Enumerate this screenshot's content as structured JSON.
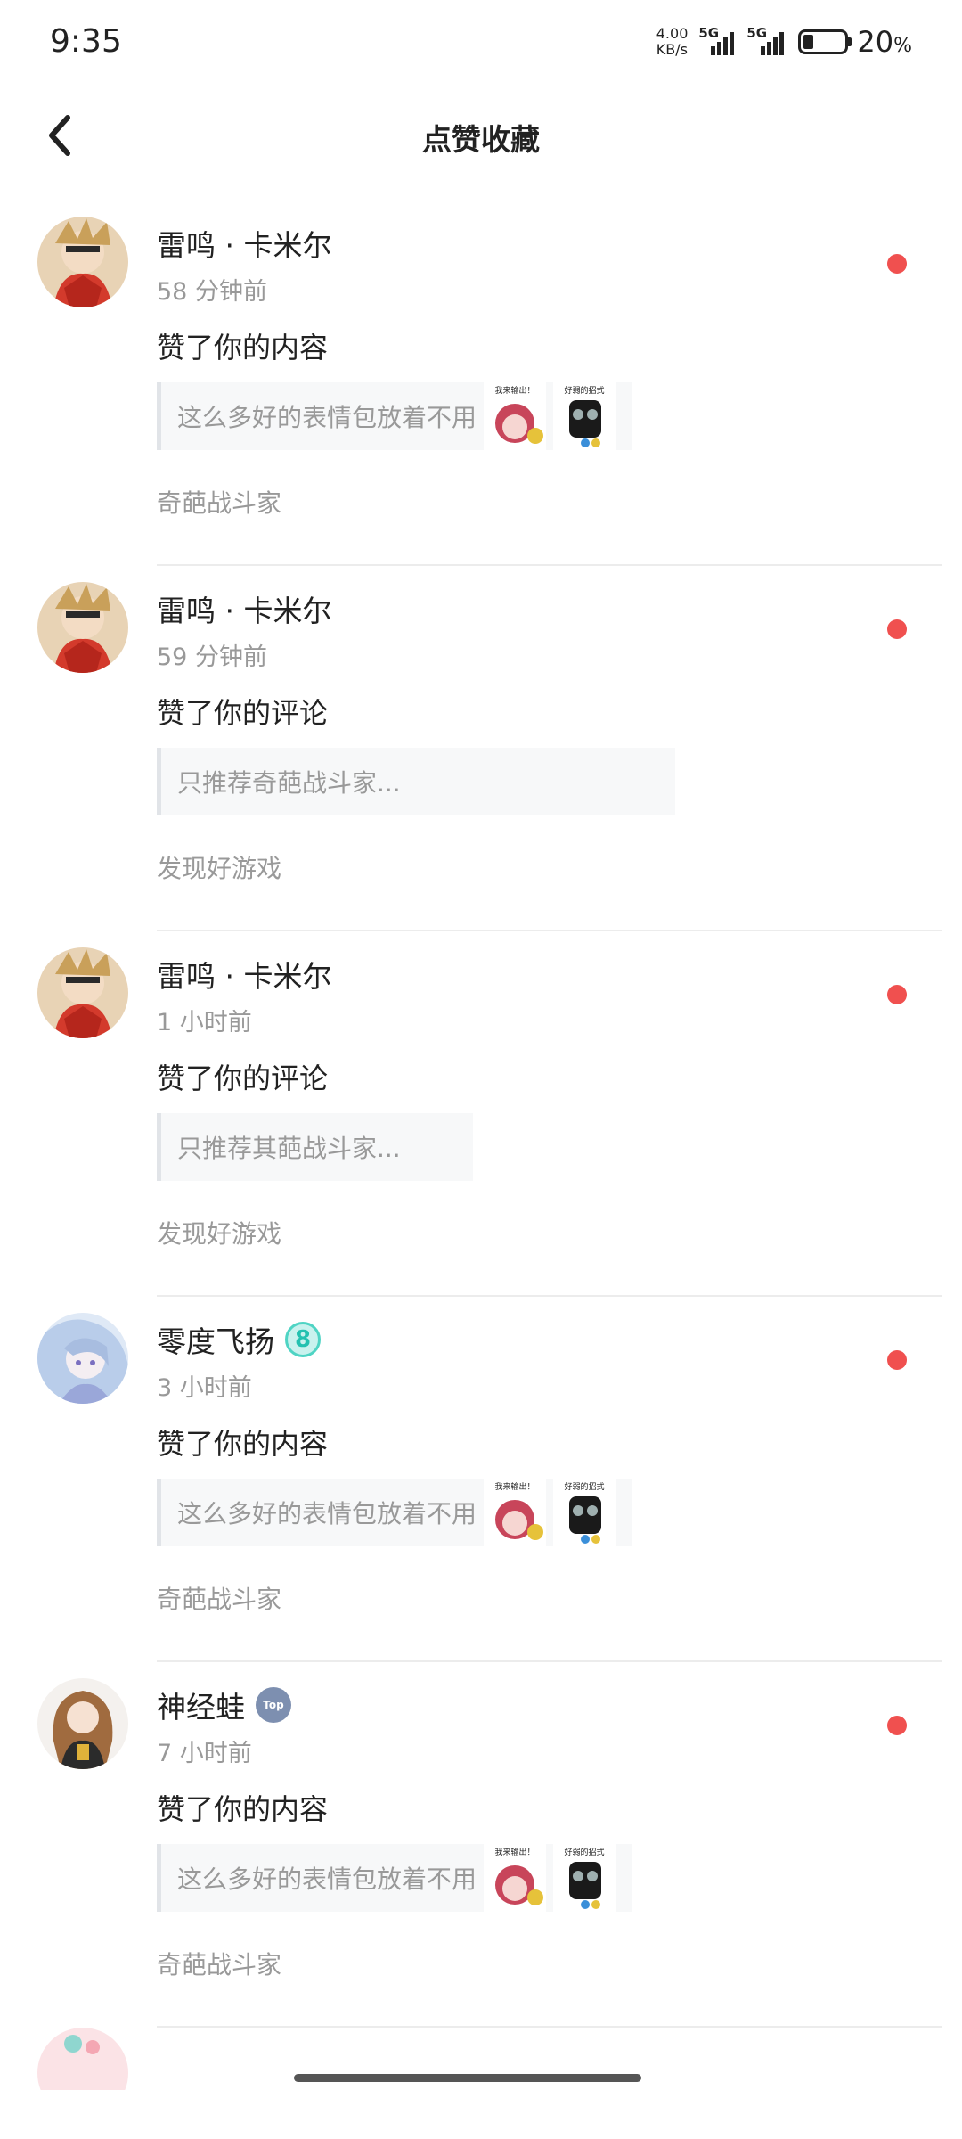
{
  "status_bar": {
    "time": "9:35",
    "net_speed_value": "4.00",
    "net_speed_unit": "KB/s",
    "sim1_label": "5G",
    "sim2_label": "5G",
    "battery_pct": "20",
    "battery_pct_sign": "%"
  },
  "header": {
    "title": "点赞收藏",
    "back_icon": "chevron-left-icon"
  },
  "colors": {
    "unread_dot": "#f0504f",
    "muted_text": "#999999",
    "quote_bg": "#f7f8f9"
  },
  "notifications": [
    {
      "user": "雷鸣 · 卡米尔",
      "time": "58 分钟前",
      "action": "赞了你的内容",
      "quote": "这么多好的表情包放着不用",
      "sticker1_text": "我来输出！",
      "sticker2_text": "好弱的招式",
      "source": "奇葩战斗家",
      "unread": true
    },
    {
      "user": "雷鸣 · 卡米尔",
      "time": "59 分钟前",
      "action": "赞了你的评论",
      "quote": "只推荐奇葩战斗家...",
      "source": "发现好游戏",
      "unread": true
    },
    {
      "user": "雷鸣 · 卡米尔",
      "time": "1 小时前",
      "action": "赞了你的评论",
      "quote": "只推荐其葩战斗家...",
      "source": "发现好游戏",
      "unread": true
    },
    {
      "user": "零度飞扬",
      "badge": "8",
      "time": "3 小时前",
      "action": "赞了你的内容",
      "quote": "这么多好的表情包放着不用",
      "sticker1_text": "我来输出！",
      "sticker2_text": "好弱的招式",
      "source": "奇葩战斗家",
      "unread": true
    },
    {
      "user": "神经蛙",
      "badge": "Top",
      "time": "7 小时前",
      "action": "赞了你的内容",
      "quote": "这么多好的表情包放着不用",
      "sticker1_text": "我来输出！",
      "sticker2_text": "好弱的招式",
      "source": "奇葩战斗家",
      "unread": true
    }
  ]
}
